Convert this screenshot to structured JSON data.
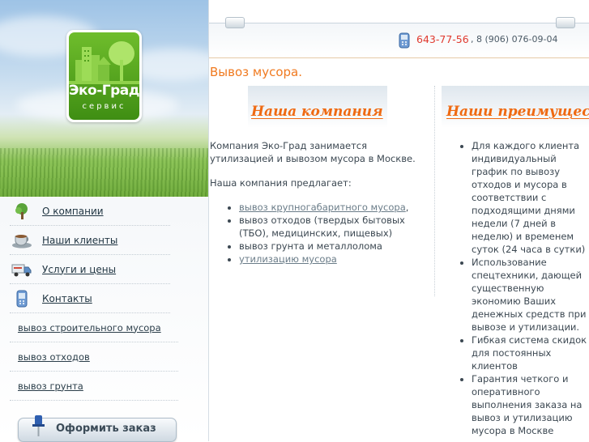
{
  "logo": {
    "name": "Эко-Град",
    "sub": "сервис"
  },
  "nav": {
    "items": [
      {
        "label": "О компании",
        "icon": "tree-icon"
      },
      {
        "label": "Наши клиенты",
        "icon": "cup-icon"
      },
      {
        "label": "Услуги и цены",
        "icon": "truck-icon"
      },
      {
        "label": "Контакты",
        "icon": "phone-icon"
      }
    ],
    "sub": [
      {
        "label": "вывоз строительного мусора"
      },
      {
        "label": "вывоз отходов"
      },
      {
        "label": "вывоз грунта"
      }
    ]
  },
  "order_button": {
    "label": "Оформить заказ"
  },
  "header": {
    "phone_main": "643-77-56",
    "phone_alt": ", 8 (906) 076-09-04"
  },
  "page_title": "Вывоз мусора.",
  "company": {
    "heading": "Наша компания",
    "intro": "Компания Эко-Град занимается утилизацией и вывозом мусора в Москве.",
    "offers_label": "Наша компания предлагает:",
    "offers": [
      {
        "text": "вывоз крупногабаритного мусора",
        "link": true,
        "suffix": ","
      },
      {
        "text": "вывоз отходов (твердых бытовых (ТБО), медицинских, пищевых)",
        "link": false,
        "suffix": ""
      },
      {
        "text": "вывоз грунта и металлолома",
        "link": false,
        "suffix": ""
      },
      {
        "text": "утилизацию мусора",
        "link": true,
        "suffix": ""
      }
    ]
  },
  "advantages": {
    "heading": "Наши преимущества",
    "items": [
      "Для каждого клиента индивидуальный график по вывозу отходов и мусора в соответствии с подходящими днями недели (7 дней в неделю) и временем суток (24 часа в сутки)",
      "Использование спецтехники, дающей существенную экономию Ваших денежных средств при вывозе и утилизации.",
      "Гибкая система скидок для постоянных клиентов",
      "Гарантия четкого и оперативного выполнения заказа на вывоз и утилизацию мусора в Москве"
    ]
  },
  "colors": {
    "accent": "#f07a20",
    "phone": "#e03a2f",
    "logo_green": "#4f9e1c"
  }
}
